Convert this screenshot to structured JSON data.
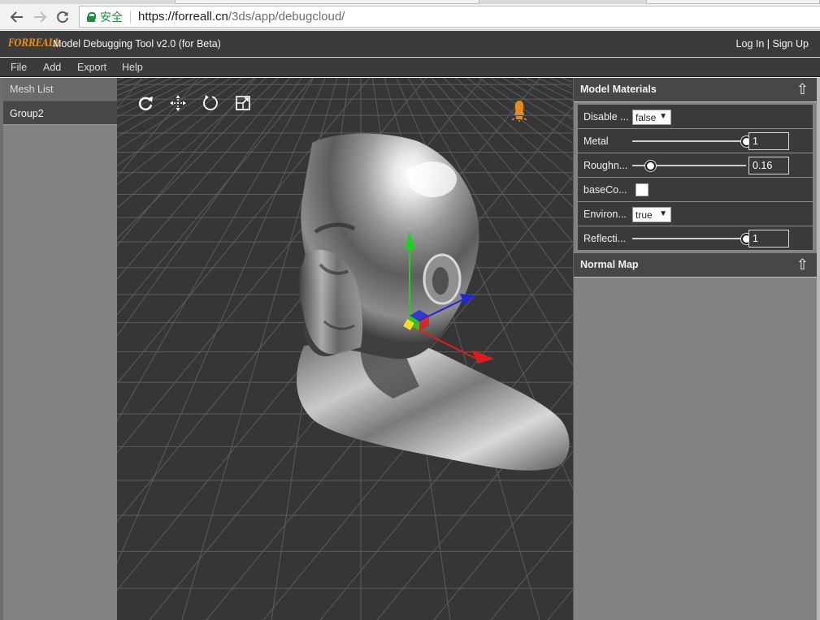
{
  "browser": {
    "back_icon": "arrow-left-icon",
    "forward_icon": "arrow-right-icon",
    "reload_icon": "reload-icon",
    "secure_label": "安全",
    "url_host": "https://forreall.cn",
    "url_path": "/3ds/app/debugcloud/",
    "secure_color": "#1e8e3e"
  },
  "app": {
    "logo_text": "FORREALL",
    "title": "Model Debugging Tool v2.0 (for Beta)",
    "login_label": "Log In",
    "auth_separator": " | ",
    "signup_label": "Sign Up",
    "brand_color": "#e58a1e"
  },
  "menu": {
    "items": [
      "File",
      "Add",
      "Export",
      "Help"
    ]
  },
  "mesh_list": {
    "header": "Mesh List",
    "items": [
      "Group2"
    ]
  },
  "viewport": {
    "tools": [
      "rotate-icon",
      "move-icon",
      "orbit-icon",
      "scale-icon"
    ],
    "light_icon": "light-bulb-icon",
    "gizmo_colors": {
      "x": "#e11b1b",
      "y": "#17d61a",
      "z": "#1c27d6",
      "center": "#f5e21c"
    }
  },
  "materials": {
    "header": "Model Materials",
    "collapse_icon": "⇧",
    "props": {
      "disable": {
        "label": "Disable ...",
        "value": "false"
      },
      "metal": {
        "label": "Metal",
        "value": "1",
        "level": 1.0
      },
      "roughness": {
        "label": "Roughn...",
        "value": "0.16",
        "level": 0.16
      },
      "basecolor": {
        "label": "baseCo...",
        "color": "#ffffff"
      },
      "environment": {
        "label": "Environ...",
        "value": "true"
      },
      "reflectivity": {
        "label": "Reflecti...",
        "value": "1",
        "level": 1.0
      }
    }
  },
  "normal_map": {
    "header": "Normal Map",
    "collapse_icon": "⇧"
  }
}
